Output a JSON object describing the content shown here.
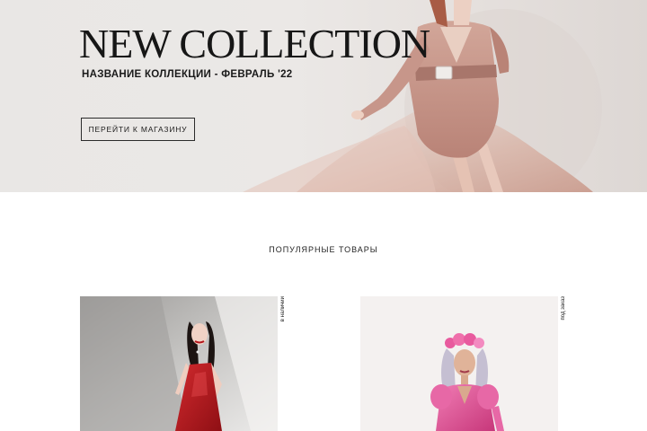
{
  "hero": {
    "title": "NEW COLLECTION",
    "subtitle": "НАЗВАНИЕ КОЛЛЕКЦИИ - ФЕВРАЛЬ '22",
    "button_label": "ПЕРЕЙТИ К МАГАЗИНУ"
  },
  "popular": {
    "title": "ПОПУЛЯРНЫЕ ТОВАРЫ",
    "products": [
      {
        "status": "в наличии"
      },
      {
        "status": "под заказ"
      }
    ]
  },
  "colors": {
    "hero_bg": "#e9e7e5",
    "dress_pink": "#c99b8f",
    "product1_dress": "#b3171d",
    "product2_dress": "#e0579c"
  }
}
